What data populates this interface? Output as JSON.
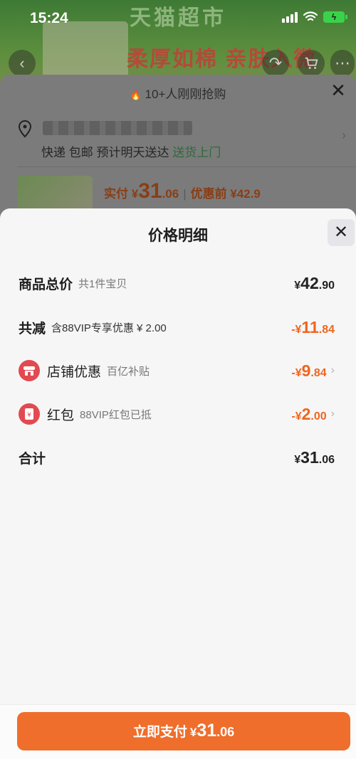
{
  "status_bar": {
    "time": "15:24"
  },
  "background": {
    "brand": "天猫超市",
    "banner": "柔厚如棉 亲肤入微",
    "hot_text": "10+人刚刚抢购",
    "shipping": {
      "method": "快递 包邮",
      "eta": "预计明天送达",
      "tag": "送货上门"
    },
    "price": {
      "paid_label": "实付 ¥",
      "paid_int": "31",
      "paid_dec": ".06",
      "before_label": "优惠前 ¥42.9"
    }
  },
  "sheet": {
    "title": "价格明细",
    "rows": [
      {
        "label": "商品总价",
        "sub": "共1件宝贝",
        "cur": "¥",
        "int": "42",
        "dec": ".90"
      },
      {
        "label": "共减",
        "sub": "含88VIP专享优惠 ¥ 2.00",
        "cur": "-¥",
        "int": "11",
        "dec": ".84"
      },
      {
        "label": "店铺优惠",
        "sub": "百亿补贴",
        "cur": "-¥",
        "int": "9",
        "dec": ".84"
      },
      {
        "label": "红包",
        "sub": "88VIP红包已抵",
        "cur": "-¥",
        "int": "2",
        "dec": ".00"
      },
      {
        "label": "合计",
        "sub": "",
        "cur": "¥",
        "int": "31",
        "dec": ".06"
      }
    ]
  },
  "pay": {
    "label": "立即支付",
    "cur": "¥",
    "int": "31",
    "dec": ".06"
  },
  "colors": {
    "accent": "#ef6e2c",
    "discount": "#f0641e",
    "badge": "#e24a50"
  }
}
